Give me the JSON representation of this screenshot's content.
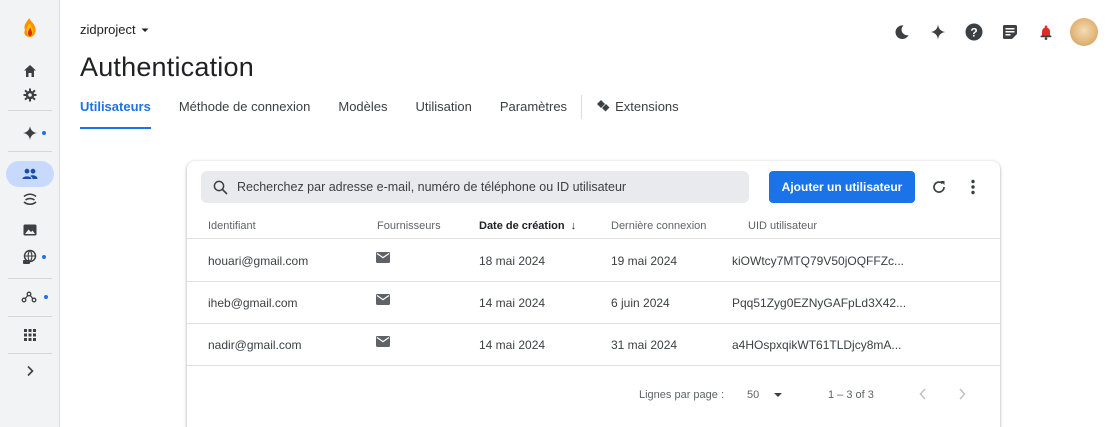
{
  "project": {
    "name": "zidproject"
  },
  "page_title": "Authentication",
  "tabs": [
    {
      "label": "Utilisateurs",
      "active": true
    },
    {
      "label": "Méthode de connexion"
    },
    {
      "label": "Modèles"
    },
    {
      "label": "Utilisation"
    },
    {
      "label": "Paramètres"
    },
    {
      "label": "Extensions",
      "icon": "extension-icon"
    }
  ],
  "search": {
    "placeholder": "Recherchez par adresse e-mail, numéro de téléphone ou ID utilisateur"
  },
  "add_user_label": "Ajouter un utilisateur",
  "table": {
    "columns": [
      "Identifiant",
      "Fournisseurs",
      "Date de création",
      "Dernière connexion",
      "UID utilisateur"
    ],
    "sort_indicator": "↓",
    "rows": [
      {
        "identifier": "houari@gmail.com",
        "provider": "email",
        "created": "18 mai 2024",
        "last_login": "19 mai 2024",
        "uid": "kiOWtcy7MTQ79V50jOQFFZc..."
      },
      {
        "identifier": "iheb@gmail.com",
        "provider": "email",
        "created": "14 mai 2024",
        "last_login": "6 juin 2024",
        "uid": "Pqq51Zyg0EZNyGAFpLd3X42..."
      },
      {
        "identifier": "nadir@gmail.com",
        "provider": "email",
        "created": "14 mai 2024",
        "last_login": "31 mai 2024",
        "uid": "a4HOspxqikWT61TLDjcy8mA..."
      }
    ]
  },
  "pagination": {
    "rows_per_page_label": "Lignes par page :",
    "rows_per_page": "50",
    "range": "1 – 3 of 3"
  },
  "colors": {
    "accent": "#1a73e8",
    "sidebar_bg": "#f1f3f4",
    "active_nav": "#c7dafd",
    "firebase_orange": "#ff9100"
  },
  "sidebar_icons": [
    "firebase-logo",
    "home-icon",
    "settings-icon",
    "gemini-icon",
    "authentication-icon",
    "realtime-database-icon",
    "storage-icon",
    "hosting-icon",
    "app-check-icon",
    "all-products-icon",
    "expand-icon"
  ],
  "top_icons": [
    "dark-mode-icon",
    "gemini-icon",
    "help-icon",
    "release-notes-icon",
    "notifications-icon",
    "avatar"
  ]
}
